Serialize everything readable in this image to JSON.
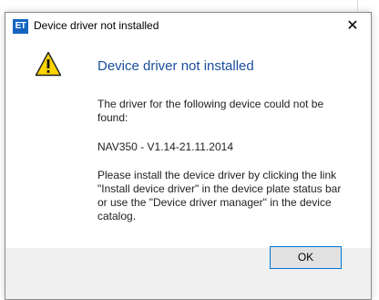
{
  "window": {
    "app_icon_text": "ET",
    "title": "Device driver not installed",
    "close_glyph": "✕",
    "close_icon": "close-icon"
  },
  "dialog": {
    "icon": "warning-icon",
    "heading": "Device driver not installed",
    "message_1": "The driver for the following device could not be found:",
    "device": "NAV350 - V1.14-21.11.2014",
    "message_2": "Please install the device driver by clicking the link \"Install device driver\" in the device plate status bar or use the \"Device driver manager\" in the device catalog.",
    "ok_label": "OK"
  },
  "colors": {
    "heading": "#1a4f9c",
    "app_icon": "#1565c0",
    "warning_fill": "#ffd400",
    "button_focus": "#0078d7"
  }
}
